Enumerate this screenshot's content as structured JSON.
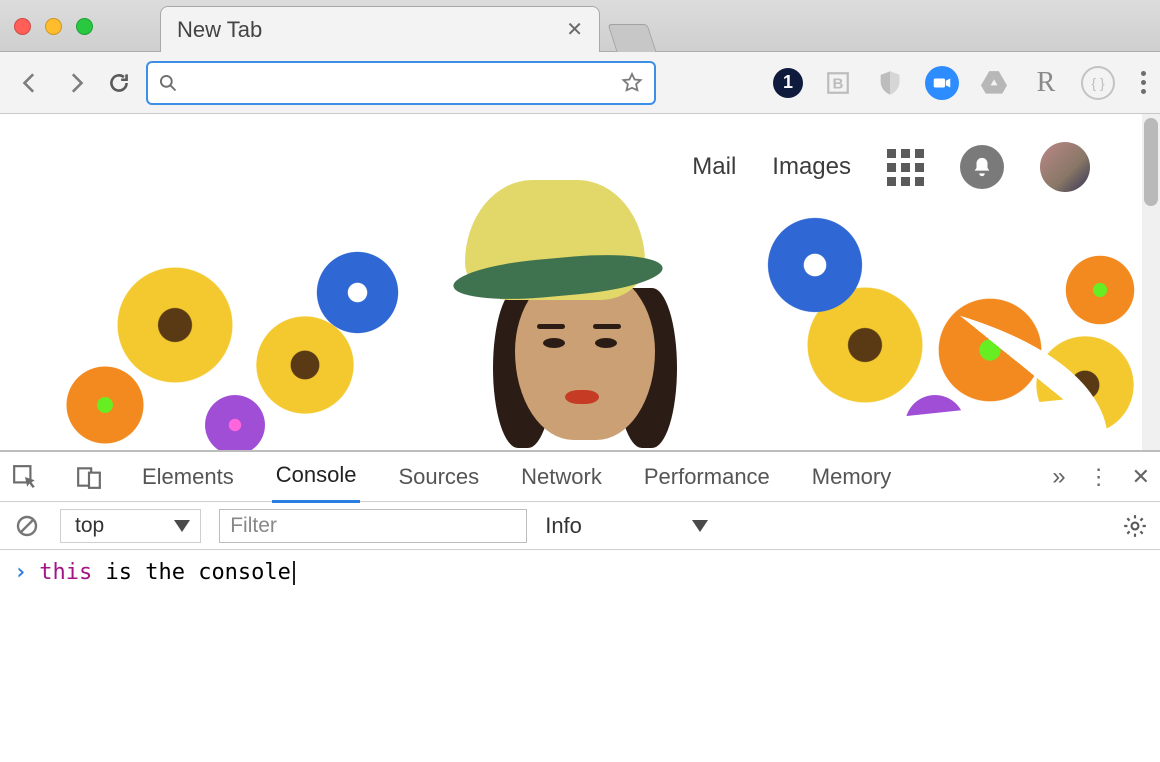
{
  "window": {
    "tab_title": "New Tab"
  },
  "toolbar": {
    "omnibox_value": "",
    "omnibox_placeholder": "",
    "badge_count": "1",
    "ext_R": "R"
  },
  "google_nav": {
    "mail": "Mail",
    "images": "Images"
  },
  "devtools": {
    "tabs": {
      "elements": "Elements",
      "console": "Console",
      "sources": "Sources",
      "network": "Network",
      "performance": "Performance",
      "memory": "Memory"
    },
    "context": "top",
    "filter_placeholder": "Filter",
    "level": "Info",
    "console_line": {
      "keyword": "this",
      "rest": " is the console"
    }
  }
}
